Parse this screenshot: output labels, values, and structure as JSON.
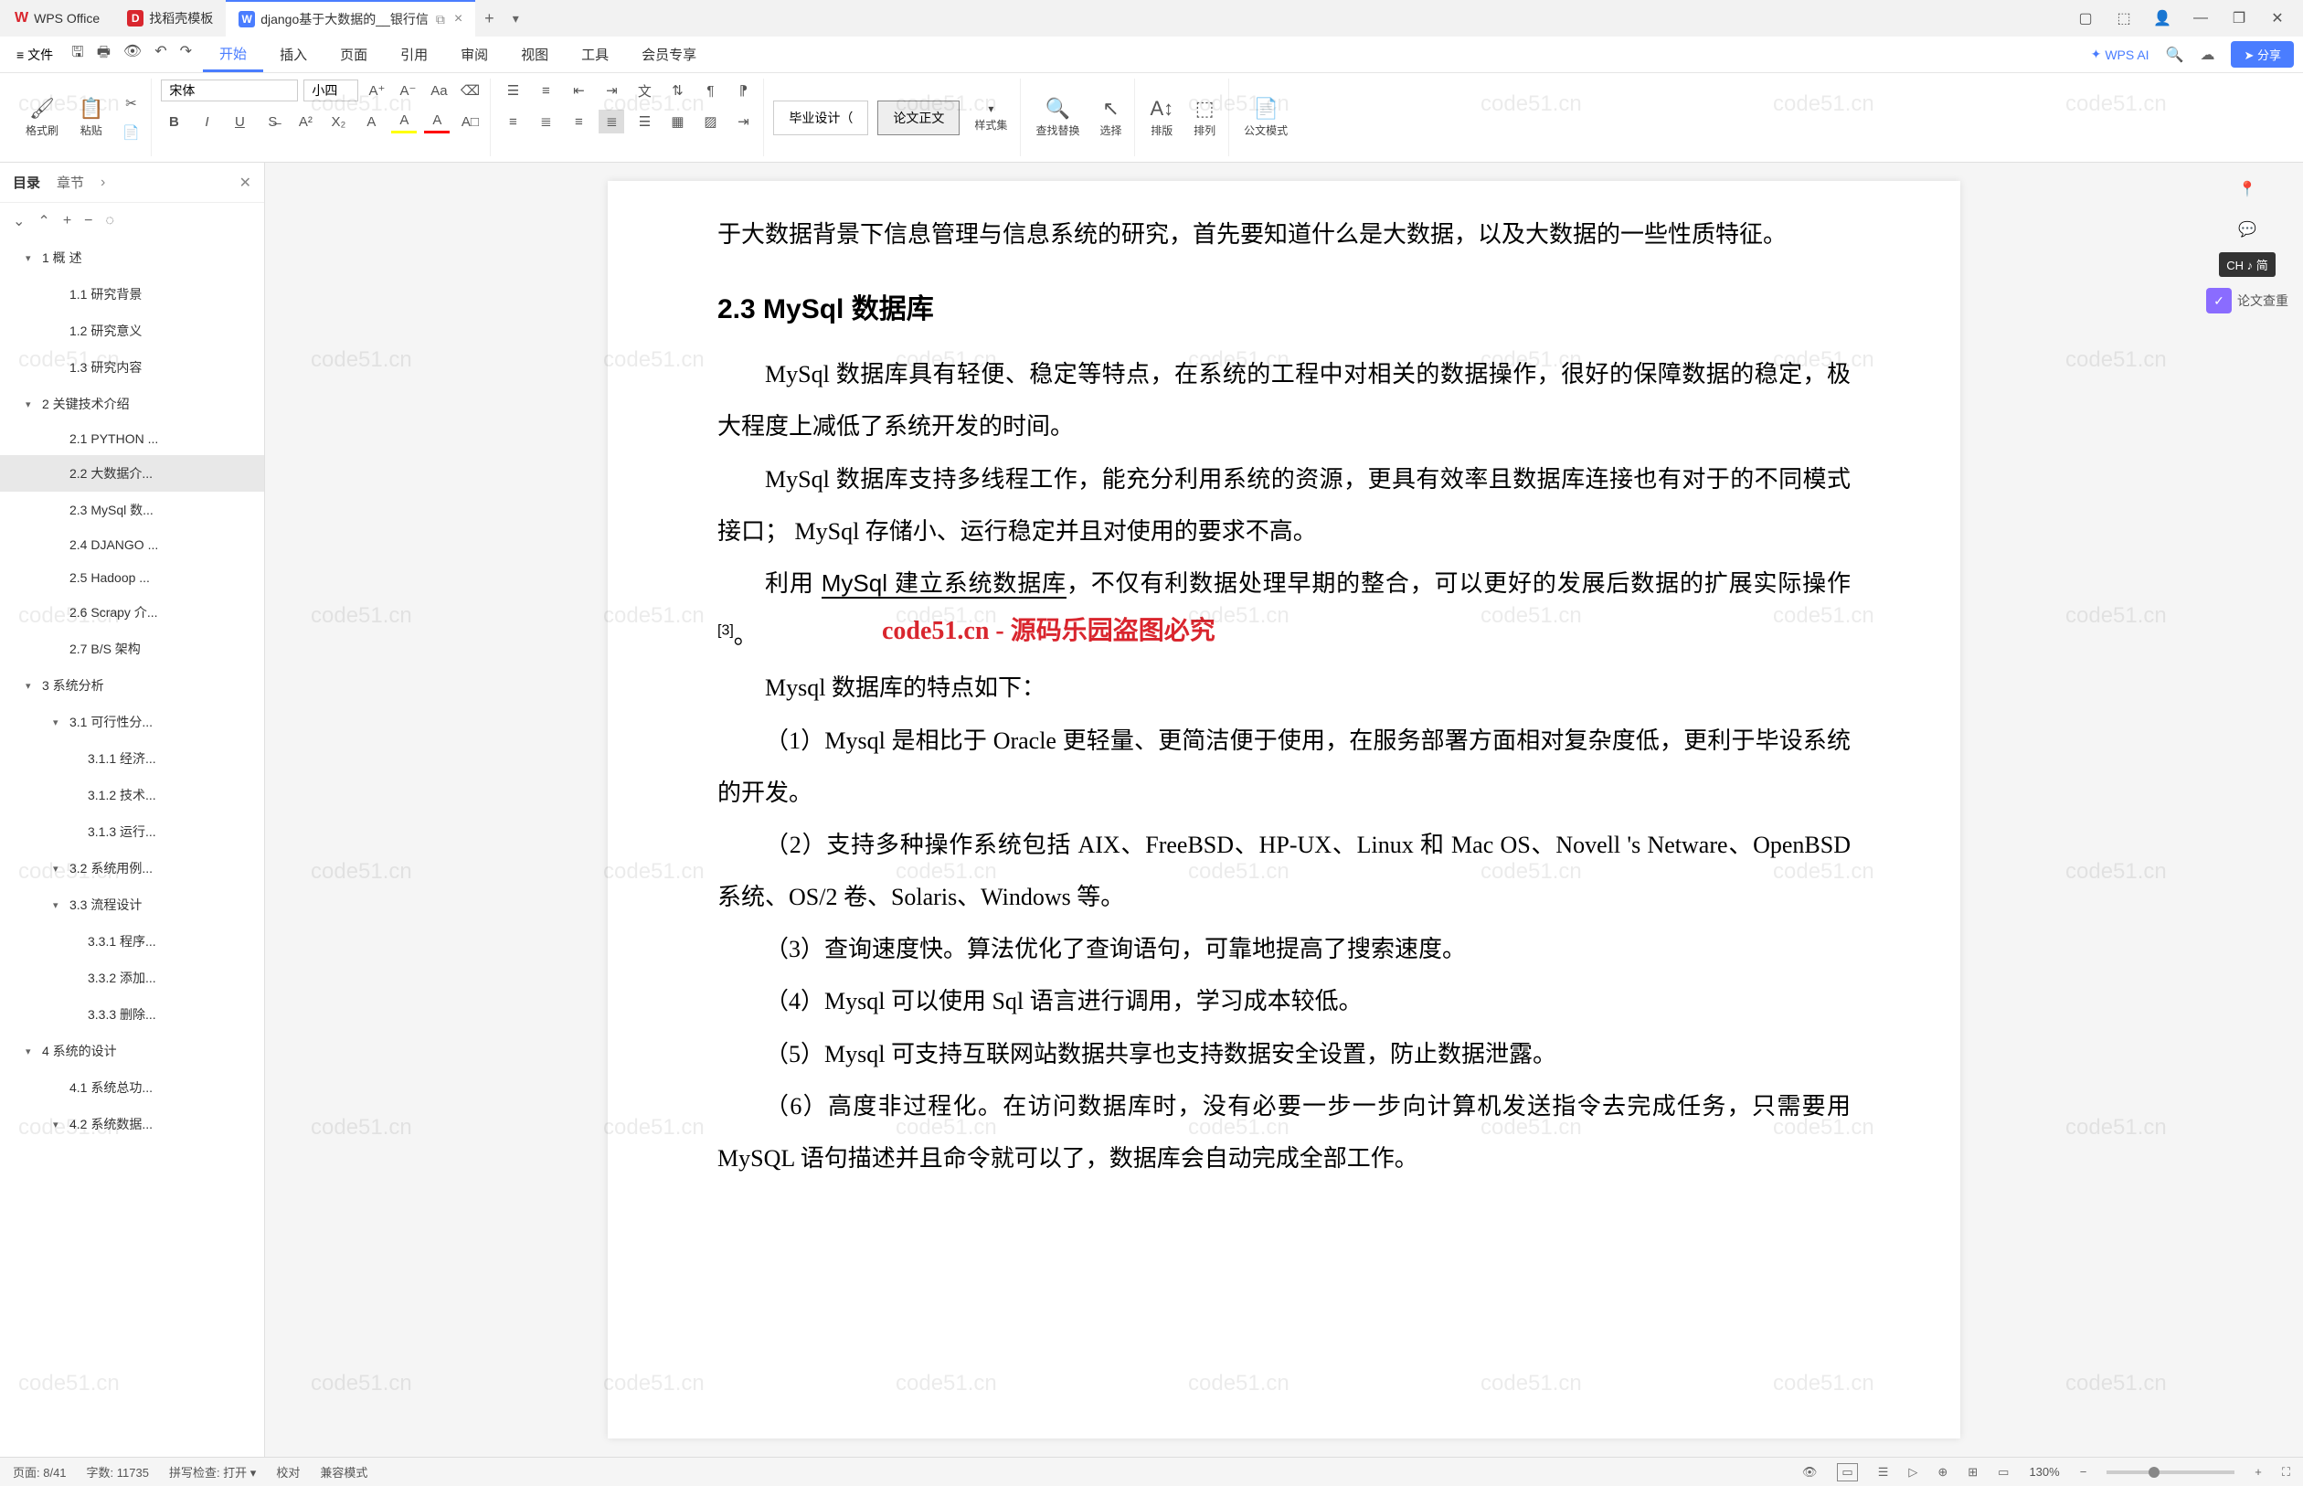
{
  "app_name": "WPS Office",
  "tabs": [
    {
      "icon": "D",
      "icon_color": "#d9262e",
      "label": "找稻壳模板"
    },
    {
      "icon": "W",
      "icon_color": "#4a7dff",
      "label": "django基于大数据的__银行信",
      "active": true
    }
  ],
  "window_controls": [
    "box-icon",
    "cube-icon",
    "avatar-icon",
    "minimize-icon",
    "restore-icon",
    "close-icon"
  ],
  "file_menu": "文件",
  "quick_access": [
    "save-icon",
    "print-icon",
    "preview-icon",
    "undo-icon",
    "redo-icon"
  ],
  "menu_tabs": [
    "开始",
    "插入",
    "页面",
    "引用",
    "审阅",
    "视图",
    "工具",
    "会员专享"
  ],
  "active_menu": "开始",
  "wps_ai": "WPS AI",
  "share": "分享",
  "ribbon": {
    "format_brush": "格式刷",
    "paste": "粘贴",
    "font_name": "宋体",
    "font_size": "小四",
    "style_thesis": "毕业设计（",
    "style_body": "论文正文",
    "style_set": "样式集",
    "find_replace": "查找替换",
    "select": "选择",
    "sort": "排版",
    "arrange": "排列",
    "gov_mode": "公文模式"
  },
  "outline": {
    "tab_toc": "目录",
    "tab_chapters": "章节",
    "items": [
      {
        "level": 1,
        "num": "1",
        "label": "概    述",
        "expandable": true
      },
      {
        "level": 2,
        "num": "1.1",
        "label": "研究背景"
      },
      {
        "level": 2,
        "num": "1.2",
        "label": "研究意义"
      },
      {
        "level": 2,
        "num": "1.3",
        "label": "研究内容"
      },
      {
        "level": 1,
        "num": "2",
        "label": "关键技术介绍",
        "expandable": true
      },
      {
        "level": 2,
        "num": "2.1",
        "label": "PYTHON ..."
      },
      {
        "level": 2,
        "num": "2.2",
        "label": "大数据介...",
        "active": true
      },
      {
        "level": 2,
        "num": "2.3",
        "label": "MySql 数..."
      },
      {
        "level": 2,
        "num": "2.4",
        "label": "DJANGO ..."
      },
      {
        "level": 2,
        "num": "2.5",
        "label": "Hadoop ..."
      },
      {
        "level": 2,
        "num": "2.6",
        "label": "Scrapy 介..."
      },
      {
        "level": 2,
        "num": "2.7",
        "label": "B/S 架构"
      },
      {
        "level": 1,
        "num": "3",
        "label": "系统分析",
        "expandable": true
      },
      {
        "level": 2,
        "num": "3.1",
        "label": "可行性分...",
        "expandable": true
      },
      {
        "level": 3,
        "num": "3.1.1",
        "label": "经济..."
      },
      {
        "level": 3,
        "num": "3.1.2",
        "label": "技术..."
      },
      {
        "level": 3,
        "num": "3.1.3",
        "label": "运行..."
      },
      {
        "level": 2,
        "num": "3.2",
        "label": "系统用例...",
        "expandable": true
      },
      {
        "level": 2,
        "num": "3.3",
        "label": "流程设计",
        "expandable": true
      },
      {
        "level": 3,
        "num": "3.3.1",
        "label": "程序..."
      },
      {
        "level": 3,
        "num": "3.3.2",
        "label": "添加..."
      },
      {
        "level": 3,
        "num": "3.3.3",
        "label": "删除..."
      },
      {
        "level": 1,
        "num": "4",
        "label": "系统的设计",
        "expandable": true
      },
      {
        "level": 2,
        "num": "4.1",
        "label": "系统总功..."
      },
      {
        "level": 2,
        "num": "4.2",
        "label": "系统数据...",
        "expandable": true
      }
    ]
  },
  "document": {
    "p_intro": "于大数据背景下信息管理与信息系统的研究，首先要知道什么是大数据，以及大数据的一些性质特征。",
    "h2": "2.3 MySql 数据库",
    "p1": "MySql 数据库具有轻便、稳定等特点，在系统的工程中对相关的数据操作，很好的保障数据的稳定，极大程度上减低了系统开发的时间。",
    "p2": "MySql 数据库支持多线程工作，能充分利用系统的资源，更具有效率且数据库连接也有对于的不同模式接口； MySql 存储小、运行稳定并且对使用的要求不高。",
    "p3a": "利用 ",
    "p3b": "MySql 建立系统数据库",
    "p3c": "，不仅有利数据处理早期的整合，可以更好的发展后数据的扩展实际操作",
    "p3d": "[3]",
    "p3e": "。",
    "red_overlay": "code51.cn - 源码乐园盗图必究",
    "p4": "Mysql 数据库的特点如下：",
    "p5": "（1）Mysql 是相比于 Oracle 更轻量、更简洁便于使用，在服务部署方面相对复杂度低，更利于毕设系统的开发。",
    "p6": "（2）支持多种操作系统包括 AIX、FreeBSD、HP-UX、Linux 和 Mac OS、Novell 's Netware、OpenBSD 系统、OS/2 卷、Solaris、Windows 等。",
    "p7": "（3）查询速度快。算法优化了查询语句，可靠地提高了搜索速度。",
    "p8": "（4）Mysql 可以使用 Sql 语言进行调用，学习成本较低。",
    "p9": "（5）Mysql 可支持互联网站数据共享也支持数据安全设置，防止数据泄露。",
    "p10": "（6）高度非过程化。在访问数据库时，没有必要一步一步向计算机发送指令去完成任务，只需要用 MySQL 语句描述并且命令就可以了，数据库会自动完成全部工作。"
  },
  "right_panel": {
    "lang": "CH ♪ 简",
    "check": "论文查重"
  },
  "statusbar": {
    "page": "页面: 8/41",
    "words": "字数: 11735",
    "spellcheck": "拼写检查: 打开",
    "proof": "校对",
    "compat": "兼容模式",
    "zoom": "130%"
  },
  "watermark_text": "code51.cn"
}
